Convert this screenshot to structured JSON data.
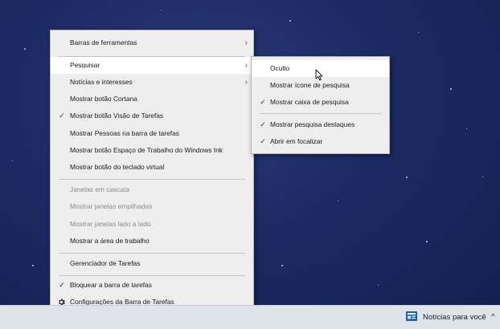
{
  "context_menu": {
    "items": [
      {
        "label": "Barras de ferramentas",
        "has_submenu": true
      },
      {
        "label": "Pesquisar",
        "has_submenu": true
      },
      {
        "label": "Notícias e interesses",
        "has_submenu": true
      },
      {
        "label": "Mostrar botão Cortana"
      },
      {
        "label": "Mostrar botão Visão de Tarefas",
        "checked": true
      },
      {
        "label": "Mostrar Pessoas na barra de tarefas"
      },
      {
        "label": "Mostrar botão Espaço de Trabalho do Windows Ink"
      },
      {
        "label": "Mostrar botão do teclado virtual"
      },
      {
        "label": "Janelas em cascata",
        "disabled": true
      },
      {
        "label": "Mostrar janelas empilhadas",
        "disabled": true
      },
      {
        "label": "Mostrar janelas lado a lado",
        "disabled": true
      },
      {
        "label": "Mostrar a área de trabalho"
      },
      {
        "label": "Gerenciador de Tarefas"
      },
      {
        "label": "Bloquear a barra de tarefas",
        "checked": true
      },
      {
        "label": "Configurações da Barra de Tarefas",
        "icon": "gear-icon"
      }
    ]
  },
  "search_submenu": {
    "items": [
      {
        "label": "Oculto"
      },
      {
        "label": "Mostrar ícone de pesquisa"
      },
      {
        "label": "Mostrar caixa de pesquisa",
        "checked": true
      },
      {
        "label": "Mostrar pesquisa destaques",
        "checked": true
      },
      {
        "label": "Abrir em focalizar",
        "checked": true
      }
    ]
  },
  "taskbar": {
    "news_label": "Notícias para você",
    "news_icon": "news-icon",
    "tray_icon": "chevron-icon"
  },
  "symbols": {
    "check": "✓",
    "chevron": "›",
    "tray_chevron": "^"
  },
  "colors": {
    "menu_bg": "#eeeeee",
    "hover_bg": "#ffffff",
    "taskbar_bg": "#dfe3ea",
    "desktop_bg": "#1c2a63"
  }
}
